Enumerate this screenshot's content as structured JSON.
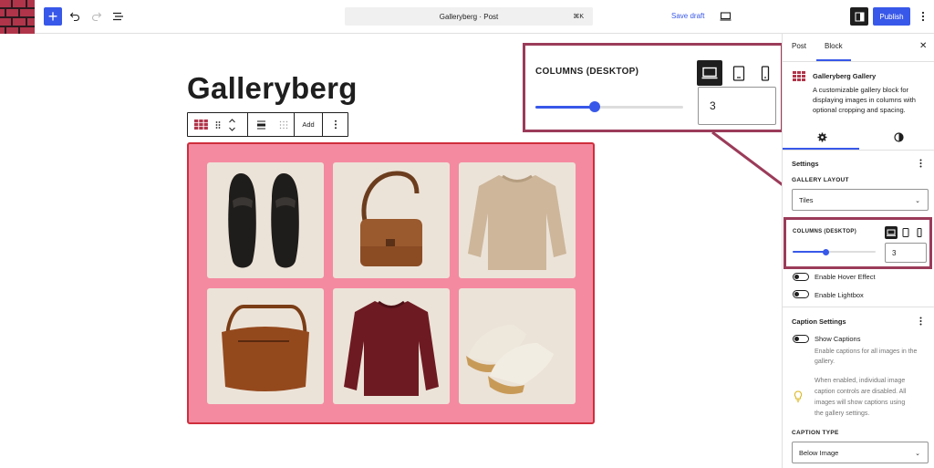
{
  "topbar": {
    "add_label": "+",
    "command_text": "Galleryberg · Post",
    "command_shortcut": "⌘K",
    "save_draft": "Save draft",
    "publish": "Publish"
  },
  "post": {
    "title": "Galleryberg",
    "toolbar_add": "Add"
  },
  "gallery": {
    "items": [
      "black-loafers",
      "brown-crossbody-bag",
      "beige-sweater",
      "brown-leather-hobo-bag",
      "burgundy-sweatshirt",
      "white-sneakers"
    ]
  },
  "callout": {
    "label": "COLUMNS (DESKTOP)",
    "value": "3",
    "slider_fraction": 0.4
  },
  "sidebar": {
    "tab_post": "Post",
    "tab_block": "Block",
    "block_name": "Galleryberg Gallery",
    "block_desc_1": "A customizable gallery block for",
    "block_desc_2": "displaying images in columns with",
    "block_desc_3": "optional cropping and spacing.",
    "settings_title": "Settings",
    "gallery_layout_label": "GALLERY LAYOUT",
    "gallery_layout_value": "Tiles",
    "columns_label": "COLUMNS (DESKTOP)",
    "columns_value": "3",
    "hover_effect": "Enable Hover Effect",
    "lightbox": "Enable Lightbox",
    "caption_settings": "Caption Settings",
    "show_captions": "Show Captions",
    "show_captions_help_1": "Enable captions for all images in the",
    "show_captions_help_2": "gallery.",
    "notice_1": "When enabled, individual image",
    "notice_2": "caption controls are disabled. All",
    "notice_3": "images will show captions using",
    "notice_4": "the gallery settings.",
    "caption_type_label": "CAPTION TYPE",
    "caption_type_value": "Below Image"
  },
  "colors": {
    "accent": "#3858e9",
    "gallery_bg": "#f48aa0",
    "highlight": "#9b3b5a"
  }
}
